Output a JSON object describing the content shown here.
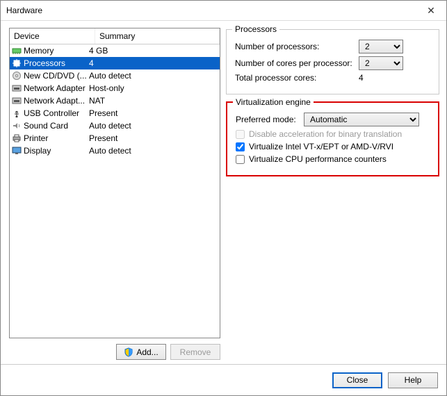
{
  "window": {
    "title": "Hardware"
  },
  "list": {
    "headers": {
      "device": "Device",
      "summary": "Summary"
    },
    "rows": [
      {
        "device": "Memory",
        "summary": "4 GB",
        "icon": "memory-icon",
        "selected": false
      },
      {
        "device": "Processors",
        "summary": "4",
        "icon": "cpu-icon",
        "selected": true
      },
      {
        "device": "New CD/DVD (...",
        "summary": "Auto detect",
        "icon": "cd-icon",
        "selected": false
      },
      {
        "device": "Network Adapter",
        "summary": "Host-only",
        "icon": "nic-icon",
        "selected": false
      },
      {
        "device": "Network Adapt...",
        "summary": "NAT",
        "icon": "nic-icon",
        "selected": false
      },
      {
        "device": "USB Controller",
        "summary": "Present",
        "icon": "usb-icon",
        "selected": false
      },
      {
        "device": "Sound Card",
        "summary": "Auto detect",
        "icon": "sound-icon",
        "selected": false
      },
      {
        "device": "Printer",
        "summary": "Present",
        "icon": "printer-icon",
        "selected": false
      },
      {
        "device": "Display",
        "summary": "Auto detect",
        "icon": "display-icon",
        "selected": false
      }
    ],
    "buttons": {
      "add": "Add...",
      "remove": "Remove"
    }
  },
  "processors": {
    "legend": "Processors",
    "num_label": "Number of processors:",
    "num_value": "2",
    "cores_label": "Number of cores per processor:",
    "cores_value": "2",
    "total_label": "Total processor cores:",
    "total_value": "4"
  },
  "virt": {
    "legend": "Virtualization engine",
    "mode_label": "Preferred mode:",
    "mode_value": "Automatic",
    "chk1": {
      "label": "Disable acceleration for binary translation",
      "checked": false
    },
    "chk2": {
      "label": "Virtualize Intel VT-x/EPT or AMD-V/RVI",
      "checked": true
    },
    "chk3": {
      "label": "Virtualize CPU performance counters",
      "checked": false
    }
  },
  "footer": {
    "close": "Close",
    "help": "Help"
  }
}
